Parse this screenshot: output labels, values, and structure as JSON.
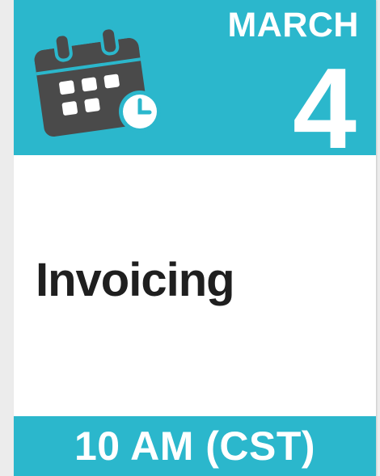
{
  "event": {
    "month": "MARCH",
    "day": "4",
    "title": "Invoicing",
    "time": "10 AM (CST)"
  },
  "colors": {
    "accent": "#2bb7cc",
    "icon_dark": "#4a4a4a",
    "title_text": "#1f1f1f",
    "background": "#ffffff"
  },
  "icons": {
    "calendar": "calendar-clock-icon"
  }
}
